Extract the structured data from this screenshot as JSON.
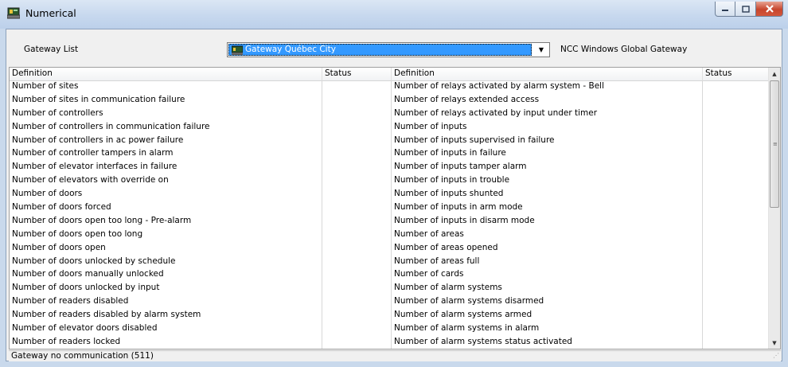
{
  "window": {
    "title": "Numerical",
    "icon": "gateway-app-icon"
  },
  "gateway": {
    "label": "Gateway List",
    "selected": "Gateway Québec City",
    "name": "NCC Windows Global Gateway"
  },
  "table": {
    "headers": [
      "Definition",
      "Status",
      "Definition",
      "Status"
    ],
    "left": [
      "Number of sites",
      "Number of sites in communication failure",
      "Number of controllers",
      "Number of controllers in communication failure",
      "Number of controllers in ac power failure",
      "Number of controller tampers in alarm",
      "Number of elevator interfaces in failure",
      "Number of elevators with override on",
      "Number of doors",
      "Number of doors forced",
      "Number of doors open too long - Pre-alarm",
      "Number of doors open too long",
      "Number of doors open",
      "Number of doors unlocked by schedule",
      "Number of doors manually unlocked",
      "Number of doors unlocked by input",
      "Number of readers disabled",
      "Number of readers disabled by alarm system",
      "Number of elevator doors disabled",
      "Number of readers locked"
    ],
    "right": [
      "Number of relays activated by alarm system - Bell",
      "Number of relays extended access",
      "Number of relays activated by input under timer",
      "Number of inputs",
      "Number of inputs supervised in failure",
      "Number of inputs in failure",
      "Number of inputs tamper alarm",
      "Number of inputs in trouble",
      "Number of inputs shunted",
      "Number of inputs in arm mode",
      "Number of inputs in disarm mode",
      "Number of areas",
      "Number of areas opened",
      "Number of areas full",
      "Number of cards",
      "Number of alarm systems",
      "Number of alarm systems disarmed",
      "Number of alarm systems armed",
      "Number of alarm systems in alarm",
      "Number of alarm systems status activated"
    ]
  },
  "status": {
    "text": "Gateway no communication (511)"
  },
  "colors": {
    "selection": "#3399ff",
    "close_button": "#c7462d"
  }
}
